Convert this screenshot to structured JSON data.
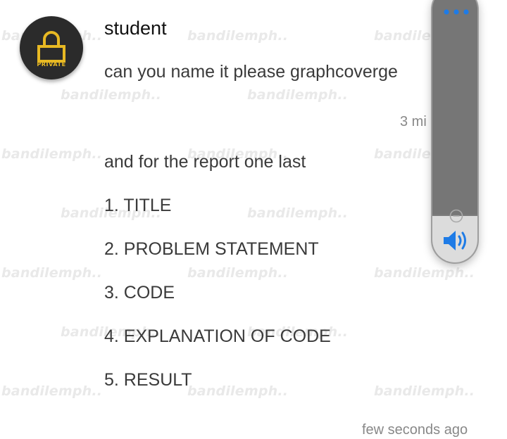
{
  "watermark": "bandilemph..",
  "contact": {
    "name": "student",
    "avatar_badge": "PRIVATE",
    "avatar_icon": "lock-icon"
  },
  "messages": [
    {
      "text": "can you name it please graphcoverge",
      "time": "3 mi"
    },
    {
      "lines": [
        "and for the report one last",
        "1. TITLE",
        "2. PROBLEM STATEMENT",
        "3. CODE",
        "4. EXPLANATION OF CODE",
        "5. RESULT"
      ],
      "time": "few seconds ago"
    }
  ],
  "volume_overlay": {
    "menu_icon": "more-dots-icon",
    "minus_icon": "minus-circle-icon",
    "speaker_icon": "speaker-volume-icon",
    "level": 0.17,
    "colors": {
      "panel": "#7c7c7c",
      "fill": "#dcdcdc",
      "accent": "#1e7be6"
    }
  },
  "colors": {
    "badge_gold": "#e8b923",
    "avatar_bg": "#2b2b2b"
  }
}
